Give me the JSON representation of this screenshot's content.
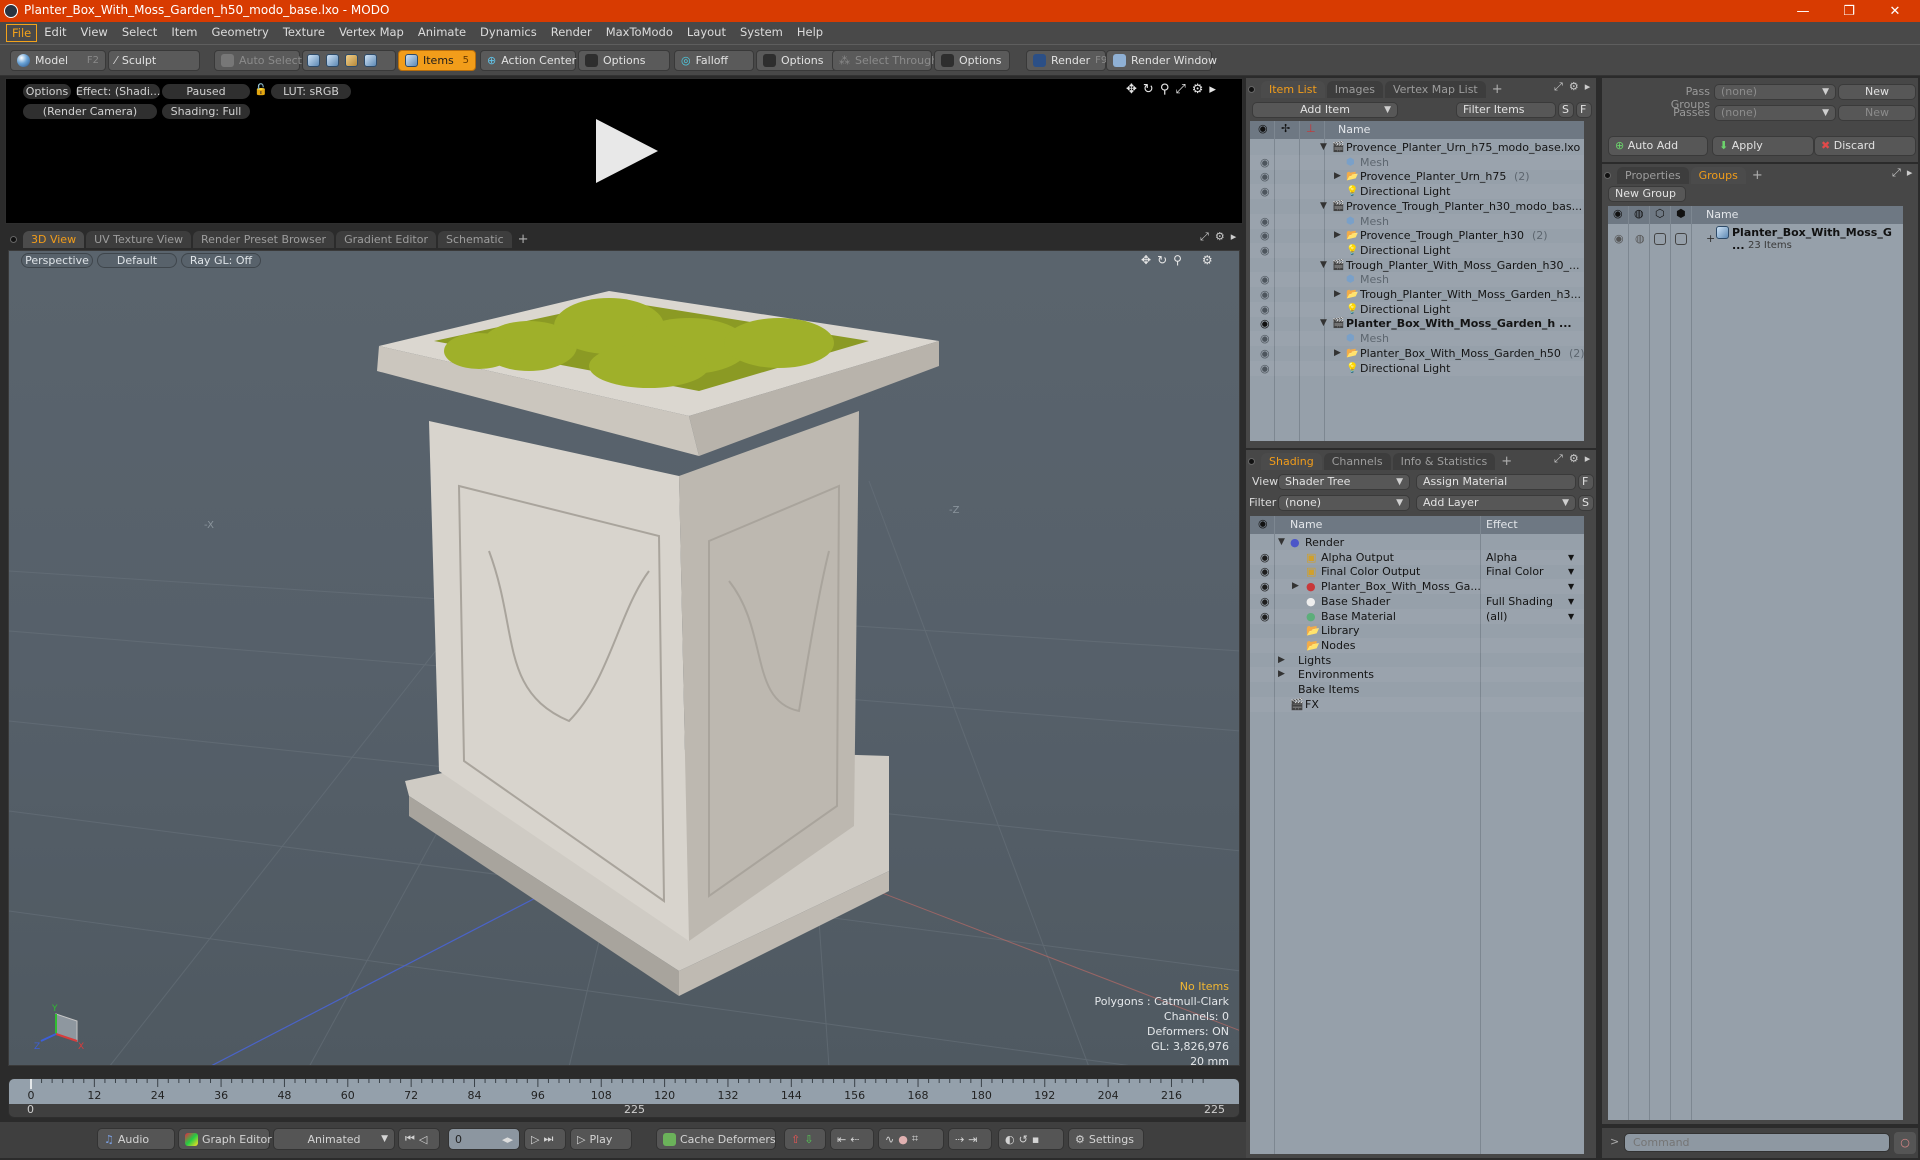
{
  "window": {
    "title": "Planter_Box_With_Moss_Garden_h50_modo_base.lxo - MODO",
    "controls": {
      "minimize": "—",
      "restore": "❐",
      "close": "✕"
    }
  },
  "menu": [
    "File",
    "Edit",
    "View",
    "Select",
    "Item",
    "Geometry",
    "Texture",
    "Vertex Map",
    "Animate",
    "Dynamics",
    "Render",
    "MaxToModo",
    "Layout",
    "System",
    "Help"
  ],
  "toolbar": {
    "model": "Model",
    "model_key": "F2",
    "sculpt": "Sculpt",
    "auto_select": "Auto Select",
    "items": "Items",
    "items_key": "5",
    "action_center": "Action Center",
    "options1": "Options",
    "falloff": "Falloff",
    "options2": "Options",
    "select_through": "Select Through",
    "options3": "Options",
    "render": "Render",
    "render_key": "F9",
    "render_window": "Render Window"
  },
  "render_preview": {
    "options": "Options",
    "effect": "Effect: (Shadi...",
    "paused": "Paused",
    "lut": "LUT: sRGB",
    "camera": "(Render Camera)",
    "shading": "Shading: Full"
  },
  "viewport": {
    "tabs": [
      "3D View",
      "UV Texture View",
      "Render Preset Browser",
      "Gradient Editor",
      "Schematic"
    ],
    "active_tab": "3D View",
    "projection": "Perspective",
    "style": "Default",
    "raygl": "Ray GL: Off",
    "axis_labels": {
      "x": "X",
      "y": "Y",
      "z": "Z",
      "neg_x": "-X",
      "neg_z": "-Z"
    },
    "info": {
      "selection": "No Items",
      "polygons": "Polygons : Catmull-Clark",
      "channels": "Channels: 0",
      "deformers": "Deformers: ON",
      "gl": "GL: 3,826,976",
      "grid": "20 mm"
    }
  },
  "timeline": {
    "ticks": [
      "0",
      "12",
      "24",
      "36",
      "48",
      "60",
      "72",
      "84",
      "96",
      "108",
      "120",
      "132",
      "144",
      "156",
      "168",
      "180",
      "192",
      "204",
      "216"
    ],
    "range_start": "0",
    "range_mid": "225",
    "range_end": "225",
    "current_frame_fraction": 0
  },
  "transport": {
    "audio": "Audio",
    "graph_editor": "Graph Editor",
    "animated": "Animated",
    "frame": "0",
    "play": "Play",
    "cache_deformers": "Cache Deformers",
    "settings": "Settings"
  },
  "item_list": {
    "tabs": [
      "Item List",
      "Images",
      "Vertex Map List"
    ],
    "active_tab": "Item List",
    "add_item": "Add Item",
    "filter": "Filter Items",
    "s_btn": "S",
    "f_btn": "F",
    "name_header": "Name",
    "rows": [
      {
        "label": "Provence_Planter_Urn_h75_modo_base.lxo",
        "type": "scene",
        "level": 0,
        "expand": "▼",
        "count": "",
        "bold": false,
        "dim": false,
        "eye": false
      },
      {
        "label": "Mesh",
        "type": "mesh",
        "level": 1,
        "expand": "",
        "count": "",
        "bold": false,
        "dim": true,
        "eye": true
      },
      {
        "label": "Provence_Planter_Urn_h75",
        "type": "group",
        "level": 1,
        "expand": "▶",
        "count": "(2)",
        "bold": false,
        "dim": false,
        "eye": true
      },
      {
        "label": "Directional Light",
        "type": "light",
        "level": 1,
        "expand": "",
        "count": "",
        "bold": false,
        "dim": false,
        "eye": true
      },
      {
        "label": "Provence_Trough_Planter_h30_modo_bas...",
        "type": "scene",
        "level": 0,
        "expand": "▼",
        "count": "",
        "bold": false,
        "dim": false,
        "eye": false
      },
      {
        "label": "Mesh",
        "type": "mesh",
        "level": 1,
        "expand": "",
        "count": "",
        "bold": false,
        "dim": true,
        "eye": true
      },
      {
        "label": "Provence_Trough_Planter_h30",
        "type": "group",
        "level": 1,
        "expand": "▶",
        "count": "(2)",
        "bold": false,
        "dim": false,
        "eye": true
      },
      {
        "label": "Directional Light",
        "type": "light",
        "level": 1,
        "expand": "",
        "count": "",
        "bold": false,
        "dim": false,
        "eye": true
      },
      {
        "label": "Trough_Planter_With_Moss_Garden_h30_...",
        "type": "scene",
        "level": 0,
        "expand": "▼",
        "count": "",
        "bold": false,
        "dim": false,
        "eye": false
      },
      {
        "label": "Mesh",
        "type": "mesh",
        "level": 1,
        "expand": "",
        "count": "",
        "bold": false,
        "dim": true,
        "eye": true
      },
      {
        "label": "Trough_Planter_With_Moss_Garden_h3...",
        "type": "group",
        "level": 1,
        "expand": "▶",
        "count": "",
        "bold": false,
        "dim": false,
        "eye": true
      },
      {
        "label": "Directional Light",
        "type": "light",
        "level": 1,
        "expand": "",
        "count": "",
        "bold": false,
        "dim": false,
        "eye": true
      },
      {
        "label": "Planter_Box_With_Moss_Garden_h ...",
        "type": "scene",
        "level": 0,
        "expand": "▼",
        "count": "",
        "bold": true,
        "dim": false,
        "eye": true
      },
      {
        "label": "Mesh",
        "type": "mesh",
        "level": 1,
        "expand": "",
        "count": "",
        "bold": false,
        "dim": true,
        "eye": true
      },
      {
        "label": "Planter_Box_With_Moss_Garden_h50",
        "type": "group",
        "level": 1,
        "expand": "▶",
        "count": "(2)",
        "bold": false,
        "dim": false,
        "eye": true
      },
      {
        "label": "Directional Light",
        "type": "light",
        "level": 1,
        "expand": "",
        "count": "",
        "bold": false,
        "dim": false,
        "eye": true
      }
    ]
  },
  "shading": {
    "tabs": [
      "Shading",
      "Channels",
      "Info & Statistics"
    ],
    "active_tab": "Shading",
    "view_label": "View",
    "view_value": "Shader Tree",
    "assign_material": "Assign Material",
    "f_btn": "F",
    "filter_label": "Filter",
    "filter_value": "(none)",
    "add_layer": "Add Layer",
    "s_btn": "S",
    "name_header": "Name",
    "effect_header": "Effect",
    "rows": [
      {
        "label": "Render",
        "type": "render",
        "level": 0,
        "expand": "▼",
        "effect": "",
        "eye": false,
        "dropdown": false
      },
      {
        "label": "Alpha Output",
        "type": "output",
        "level": 1,
        "expand": "",
        "effect": "Alpha",
        "eye": true,
        "dropdown": true
      },
      {
        "label": "Final Color Output",
        "type": "output",
        "level": 1,
        "expand": "",
        "effect": "Final Color",
        "eye": true,
        "dropdown": true
      },
      {
        "label": "Planter_Box_With_Moss_Ga...",
        "type": "material-group",
        "level": 1,
        "expand": "▶",
        "effect": "",
        "eye": true,
        "dropdown": true
      },
      {
        "label": "Base Shader",
        "type": "shader",
        "level": 1,
        "expand": "",
        "effect": "Full Shading",
        "eye": true,
        "dropdown": true
      },
      {
        "label": "Base Material",
        "type": "material",
        "level": 1,
        "expand": "",
        "effect": "(all)",
        "eye": true,
        "dropdown": true
      },
      {
        "label": "Library",
        "type": "folder",
        "level": 1,
        "expand": "",
        "effect": "",
        "eye": false,
        "dropdown": false
      },
      {
        "label": "Nodes",
        "type": "folder",
        "level": 1,
        "expand": "",
        "effect": "",
        "eye": false,
        "dropdown": false
      },
      {
        "label": "Lights",
        "type": "none",
        "level": 0,
        "expand": "▶",
        "effect": "",
        "eye": false,
        "dropdown": false
      },
      {
        "label": "Environments",
        "type": "none",
        "level": 0,
        "expand": "▶",
        "effect": "",
        "eye": false,
        "dropdown": false
      },
      {
        "label": "Bake Items",
        "type": "none",
        "level": 0,
        "expand": "",
        "effect": "",
        "eye": false,
        "dropdown": false
      },
      {
        "label": "FX",
        "type": "scene",
        "level": 0,
        "expand": "",
        "effect": "",
        "eye": false,
        "dropdown": false
      }
    ]
  },
  "passes": {
    "pass_groups_label": "Pass Groups",
    "pass_groups_value": "(none)",
    "passes_label": "Passes",
    "passes_value": "(none)",
    "new1": "New",
    "new2": "New",
    "auto_add": "Auto Add",
    "apply": "Apply",
    "discard": "Discard"
  },
  "groups": {
    "tabs": [
      "Properties",
      "Groups"
    ],
    "active_tab": "Groups",
    "new_group": "New Group",
    "name_header": "Name",
    "rows": [
      {
        "label": "Planter_Box_With_Moss_G ...",
        "sub": "23 Items"
      }
    ]
  },
  "command": {
    "prompt": ">",
    "placeholder": "Command"
  },
  "colors": {
    "accent": "#f29d1a",
    "titlebar": "#d83b01",
    "list_bg": "#96a0aa",
    "viewport_bg": "#56606a"
  }
}
